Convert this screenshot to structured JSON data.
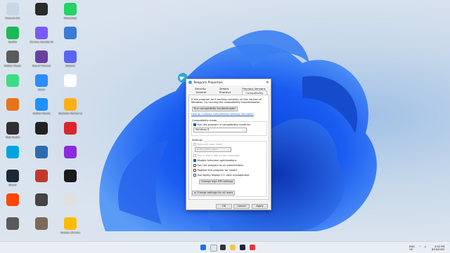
{
  "desktop": {
    "icons": [
      {
        "label": "Recycle Bin",
        "color": "#c9d6e6",
        "col": 0,
        "row": 0
      },
      {
        "label": "",
        "color": "#2a2a2a",
        "col": 1,
        "row": 0
      },
      {
        "label": "WhatsApp",
        "color": "#25d366",
        "col": 2,
        "row": 0
      },
      {
        "label": "Spotify",
        "color": "#1db954",
        "col": 0,
        "row": 1
      },
      {
        "label": "Chrome Remote Desktop",
        "color": "#7a5af5",
        "col": 1,
        "row": 1
      },
      {
        "label": "",
        "color": "#3a7bd5",
        "col": 2,
        "row": 1
      },
      {
        "label": "Roblox Player",
        "color": "#5a5a5a",
        "col": 0,
        "row": 2
      },
      {
        "label": "Sea of Thieves",
        "color": "#6b3fa0",
        "col": 1,
        "row": 2
      },
      {
        "label": "Discord",
        "color": "#5865f2",
        "col": 2,
        "row": 2
      },
      {
        "label": "",
        "color": "#3ddc84",
        "col": 0,
        "row": 3
      },
      {
        "label": "Zoom",
        "color": "#2d8cff",
        "col": 1,
        "row": 3
      },
      {
        "label": "",
        "color": "#ffffff",
        "col": 2,
        "row": 3
      },
      {
        "label": "",
        "color": "#e8731a",
        "col": 0,
        "row": 4
      },
      {
        "label": "Roblox Studio",
        "color": "#1e90ff",
        "col": 1,
        "row": 4
      },
      {
        "label": "Rockstar Games Launcher",
        "color": "#fcaf17",
        "col": 2,
        "row": 4
      },
      {
        "label": "OBS Studio",
        "color": "#302e31",
        "col": 0,
        "row": 5
      },
      {
        "label": "",
        "color": "#222222",
        "col": 1,
        "row": 5
      },
      {
        "label": "",
        "color": "#d9262c",
        "col": 2,
        "row": 5
      },
      {
        "label": "",
        "color": "#00a3e0",
        "col": 0,
        "row": 6
      },
      {
        "label": "",
        "color": "#2b6cb0",
        "col": 1,
        "row": 6
      },
      {
        "label": "",
        "color": "#8a2be2",
        "col": 2,
        "row": 6
      },
      {
        "label": "Steam",
        "color": "#1b2838",
        "col": 0,
        "row": 7
      },
      {
        "label": "",
        "color": "#c0392b",
        "col": 1,
        "row": 7
      },
      {
        "label": "",
        "color": "#1a1a1a",
        "col": 2,
        "row": 7
      },
      {
        "label": "",
        "color": "#ff4500",
        "col": 0,
        "row": 8
      },
      {
        "label": "",
        "color": "#444444",
        "col": 1,
        "row": 8
      },
      {
        "label": "",
        "color": "#e0e0e0",
        "col": 2,
        "row": 8
      },
      {
        "label": "",
        "color": "#5a5a5a",
        "col": 0,
        "row": 9
      },
      {
        "label": "",
        "color": "#7a6a5a",
        "col": 1,
        "row": 9
      },
      {
        "label": "Google Chrome",
        "color": "#fbbc05",
        "col": 2,
        "row": 9
      }
    ]
  },
  "dialog": {
    "title": "Telegram Properties",
    "close_glyph": "✕",
    "tabs": {
      "security": "Security",
      "details": "Details",
      "previous_versions": "Previous Versions",
      "general": "General",
      "shortcut": "Shortcut",
      "compatibility": "Compatibility"
    },
    "intro": "If this program isn't working correctly on this version of Windows, try running the compatibility troubleshooter.",
    "run_troubleshooter": "Run compatibility troubleshooter",
    "choose_settings_link": "How do I choose compatibility settings manually?",
    "compat_mode": {
      "heading": "Compatibility mode",
      "checkbox": "Run this program in compatibility mode for:",
      "selected_os": "Windows 8"
    },
    "settings": {
      "heading": "Settings",
      "reduced_color": "Reduced color mode",
      "color_value": "8-bit (256) color",
      "run_640": "Run in 640 x 480 screen resolution",
      "disable_fullscreen": "Disable fullscreen optimizations",
      "run_admin": "Run this program as an administrator",
      "register_restart": "Register this program for restart",
      "legacy_icc": "Use legacy display ICC color management",
      "high_dpi": "Change high DPI settings"
    },
    "all_users": "Change settings for all users",
    "ok": "OK",
    "cancel": "Cancel",
    "apply": "Apply"
  },
  "taskbar": {
    "lang": "ENG",
    "region": "US",
    "time": "3:02 PM",
    "date": "8/23/2022"
  }
}
